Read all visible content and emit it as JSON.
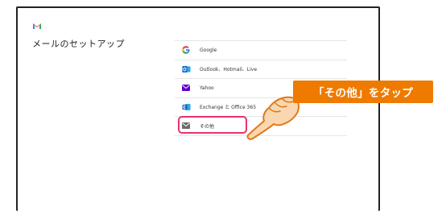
{
  "screen": {
    "title": "メールのセットアップ"
  },
  "providers": [
    {
      "label": "Google",
      "icon": "google-icon"
    },
    {
      "label": "Outlook、Hotmail、Live",
      "icon": "outlook-icon"
    },
    {
      "label": "Yahoo",
      "icon": "yahoo-mail-icon"
    },
    {
      "label": "Exchange と Office 365",
      "icon": "exchange-icon"
    },
    {
      "label": "その他",
      "icon": "mail-icon"
    }
  ],
  "annotation": {
    "callout_text": "「その他」をタップ",
    "callout_color": "#ef7a00",
    "highlight_color": "#e8336b"
  },
  "colors": {
    "gmail_red": "#ea4335",
    "outlook_blue": "#0a64c8",
    "yahoo_purple": "#5f01d1"
  }
}
